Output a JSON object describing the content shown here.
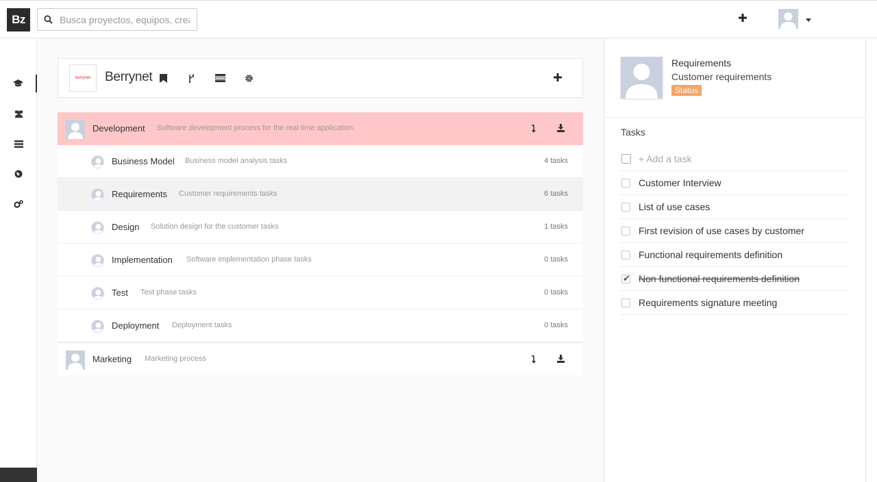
{
  "app": {
    "logo": "Bz"
  },
  "search": {
    "placeholder": "Busca proyectos, equipos, creador…"
  },
  "project": {
    "name": "Berrynet",
    "logo_text": "berrynet"
  },
  "groups": [
    {
      "name": "Development",
      "description": "Software development process for the real time application."
    },
    {
      "name": "Marketing",
      "description": "Marketing process"
    }
  ],
  "phases": [
    {
      "name": "Business Model",
      "description": "Business model analysis tasks",
      "count": "4 tasks"
    },
    {
      "name": "Requirements",
      "description": "Customer requirements tasks",
      "count": "6 tasks"
    },
    {
      "name": "Design",
      "description": "Solution design for the customer tasks",
      "count": "1 tasks"
    },
    {
      "name": "Implementation",
      "description": "Software implementation phase tasks",
      "count": "0 tasks"
    },
    {
      "name": "Test",
      "description": "Test phase tasks",
      "count": "0 tasks"
    },
    {
      "name": "Deployment",
      "description": "Deployment tasks",
      "count": "0 tasks"
    }
  ],
  "panel": {
    "title": "Requirements",
    "subtitle": "Customer requirements",
    "status": "Status",
    "tasks_heading": "Tasks",
    "add_task": "+ Add a task",
    "tasks": [
      {
        "label": "Customer Interview",
        "done": false
      },
      {
        "label": "List of use cases",
        "done": false
      },
      {
        "label": "First revision of use cases by customer",
        "done": false
      },
      {
        "label": "Functional requirements definition",
        "done": false
      },
      {
        "label": "Non functional requirements definition",
        "done": true
      },
      {
        "label": "Requirements signature meeting",
        "done": false
      }
    ]
  },
  "colors": {
    "active_group": "#ffc7c7",
    "status_badge": "#f8a462",
    "dark": "#2b2b2b"
  },
  "icons": {
    "sidebar": [
      "graduation-cap-icon",
      "users-icon",
      "list-icon",
      "globe-icon",
      "cogs-icon"
    ],
    "header": [
      "bookmark-icon",
      "branch-icon",
      "tasks-icon",
      "gear-icon",
      "plus-icon"
    ],
    "row_actions": [
      "level-down-icon",
      "download-icon"
    ]
  }
}
